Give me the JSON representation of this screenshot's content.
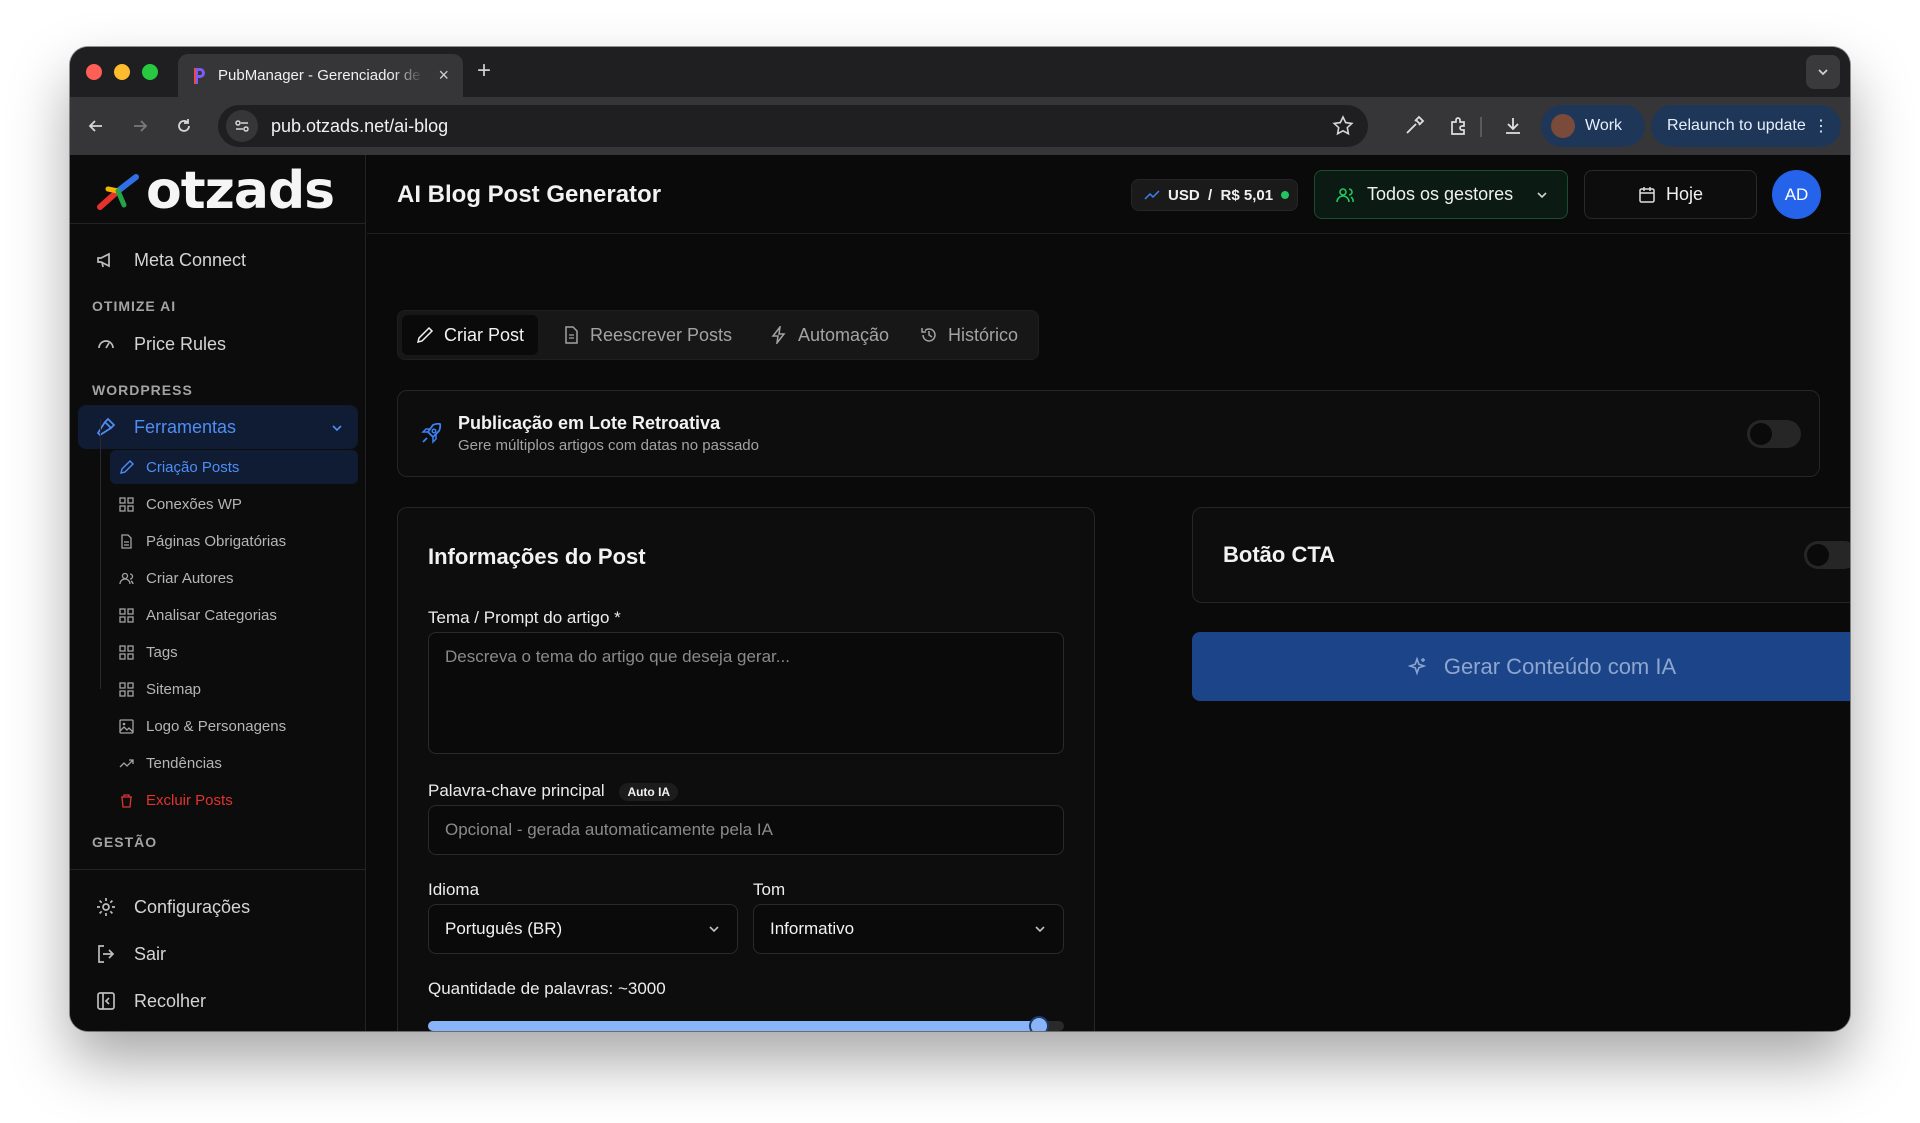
{
  "browser": {
    "tab_title": "PubManager - Gerenciador de Publicações",
    "url": "pub.otzads.net/ai-blog",
    "profile_label": "Work",
    "relaunch_label": "Relaunch to update"
  },
  "sidebar": {
    "logo_text": "otzads",
    "items": [
      {
        "label": "Meta Connect",
        "icon": "megaphone-icon"
      },
      {
        "label": "Price Rules",
        "icon": "gauge-icon"
      }
    ],
    "sections": {
      "otimize": "OTIMIZE AI",
      "wordpress": "WORDPRESS",
      "gestao": "GESTÃO"
    },
    "ferramentas_label": "Ferramentas",
    "sub_items": [
      {
        "label": "Criação Posts",
        "icon": "pencil-icon"
      },
      {
        "label": "Conexões WP",
        "icon": "grid-icon"
      },
      {
        "label": "Páginas Obrigatórias",
        "icon": "file-icon"
      },
      {
        "label": "Criar Autores",
        "icon": "users-icon"
      },
      {
        "label": "Analisar Categorias",
        "icon": "grid-icon"
      },
      {
        "label": "Tags",
        "icon": "grid-icon"
      },
      {
        "label": "Sitemap",
        "icon": "grid-icon"
      },
      {
        "label": "Logo & Personagens",
        "icon": "image-icon"
      },
      {
        "label": "Tendências",
        "icon": "trending-icon"
      },
      {
        "label": "Excluir Posts",
        "icon": "trash-icon"
      }
    ],
    "bottom": {
      "settings": "Configurações",
      "logout": "Sair",
      "collapse": "Recolher"
    }
  },
  "header": {
    "title": "AI Blog Post Generator",
    "rate": "USD  /  R$ 5,01",
    "managers": "Todos os gestores",
    "date": "Hoje",
    "avatar": "AD"
  },
  "tabs": [
    "Criar Post",
    "Reescrever Posts",
    "Automação",
    "Histórico"
  ],
  "batch": {
    "title": "Publicação em Lote Retroativa",
    "subtitle": "Gere múltiplos artigos com datas no passado",
    "enabled": false
  },
  "post_info": {
    "title": "Informações do Post",
    "topic_label": "Tema / Prompt do artigo *",
    "topic_placeholder": "Descreva o tema do artigo que deseja gerar...",
    "keyword_label": "Palavra-chave principal",
    "keyword_badge": "Auto IA",
    "keyword_placeholder": "Opcional - gerada automaticamente pela IA",
    "language_label": "Idioma",
    "language_value": "Português (BR)",
    "tone_label": "Tom",
    "tone_value": "Informativo",
    "words_label": "Quantidade de palavras: ~3000",
    "words_slider_fraction": 0.96
  },
  "cta": {
    "title": "Botão CTA",
    "enabled": false
  },
  "generate_label": "Gerar Conteúdo com IA",
  "colors": {
    "accent": "#2563eb",
    "active_text": "#4f8df5",
    "danger": "#e0332f",
    "status_green": "#22c55e"
  }
}
